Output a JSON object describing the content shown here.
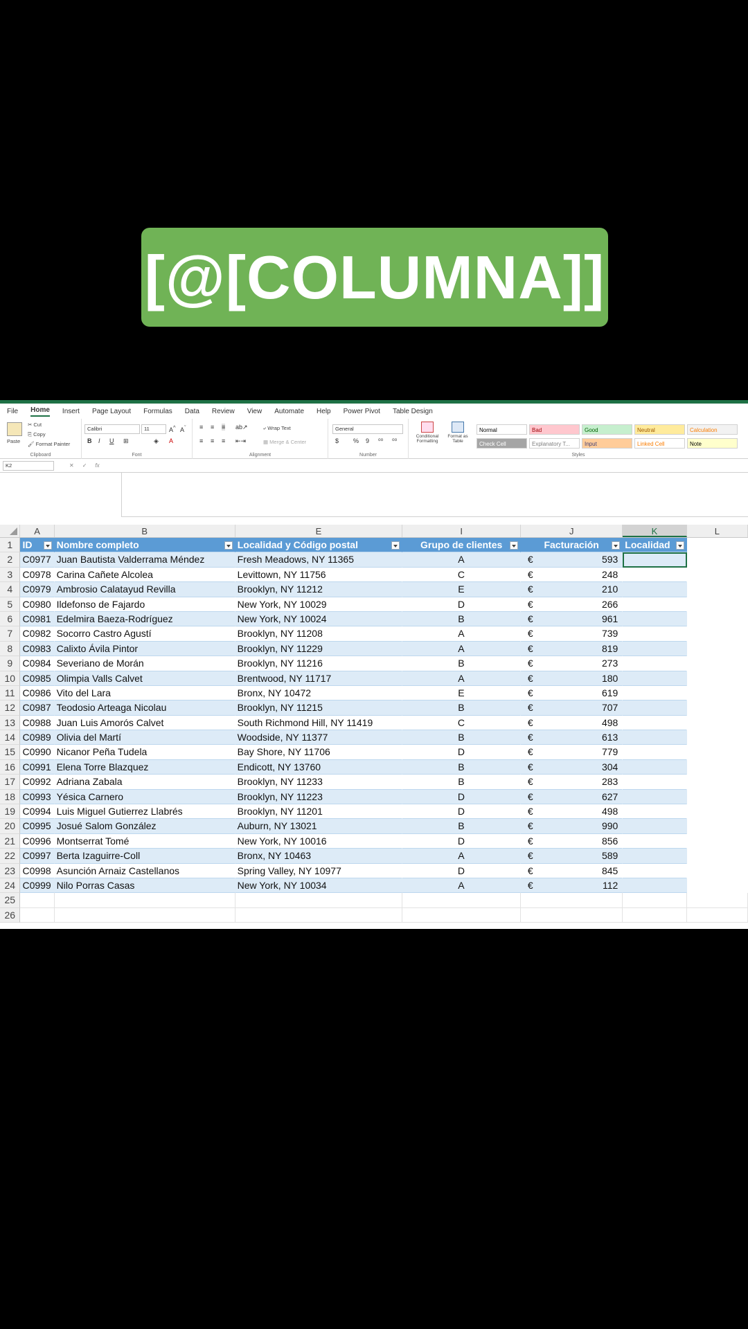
{
  "banner": {
    "title": "[@[COLUMNA]]"
  },
  "ribbon": {
    "tabs": [
      "File",
      "Home",
      "Insert",
      "Page Layout",
      "Formulas",
      "Data",
      "Review",
      "View",
      "Automate",
      "Help",
      "Power Pivot",
      "Table Design"
    ],
    "active_tab": "Home",
    "clipboard": {
      "paste": "Paste",
      "cut": "Cut",
      "copy": "Copy",
      "format_painter": "Format Painter",
      "label": "Clipboard"
    },
    "font": {
      "name": "Calibri",
      "size": "11",
      "label": "Font"
    },
    "alignment": {
      "wrap": "Wrap Text",
      "merge": "Merge & Center",
      "label": "Alignment"
    },
    "number": {
      "format": "General",
      "label": "Number"
    },
    "styles": {
      "conditional": "Conditional Formatting",
      "format_as_table": "Format as Table",
      "cells": [
        {
          "name": "Normal",
          "bg": "#ffffff",
          "fg": "#000000"
        },
        {
          "name": "Bad",
          "bg": "#ffc7ce",
          "fg": "#9c0006"
        },
        {
          "name": "Good",
          "bg": "#c6efce",
          "fg": "#006100"
        },
        {
          "name": "Neutral",
          "bg": "#ffeb9c",
          "fg": "#9c5700"
        },
        {
          "name": "Calculation",
          "bg": "#f2f2f2",
          "fg": "#fa7d00"
        },
        {
          "name": "Check Cell",
          "bg": "#a5a5a5",
          "fg": "#ffffff"
        },
        {
          "name": "Explanatory T...",
          "bg": "#ffffff",
          "fg": "#7f7f7f"
        },
        {
          "name": "Input",
          "bg": "#ffcc99",
          "fg": "#3f3f76"
        },
        {
          "name": "Linked Cell",
          "bg": "#ffffff",
          "fg": "#fa7d00"
        },
        {
          "name": "Note",
          "bg": "#ffffcc",
          "fg": "#000000"
        }
      ],
      "label": "Styles"
    }
  },
  "formula_bar": {
    "name_box": "K2",
    "value": ""
  },
  "columns": [
    "A",
    "B",
    "E",
    "I",
    "J",
    "K",
    "L"
  ],
  "table": {
    "headers": [
      "ID",
      "Nombre completo",
      "Localidad y Código postal",
      "Grupo de clientes",
      "Facturación",
      "Localidad"
    ],
    "currency": "€",
    "rows": [
      [
        "C0977",
        "Juan Bautista Valderrama Méndez",
        "Fresh Meadows, NY 11365",
        "A",
        "593"
      ],
      [
        "C0978",
        "Carina Cañete Alcolea",
        "Levittown, NY 11756",
        "C",
        "248"
      ],
      [
        "C0979",
        "Ambrosio Calatayud Revilla",
        "Brooklyn, NY 11212",
        "E",
        "210"
      ],
      [
        "C0980",
        "Ildefonso de Fajardo",
        "New York, NY 10029",
        "D",
        "266"
      ],
      [
        "C0981",
        "Edelmira Baeza-Rodríguez",
        "New York, NY 10024",
        "B",
        "961"
      ],
      [
        "C0982",
        "Socorro Castro Agustí",
        "Brooklyn, NY 11208",
        "A",
        "739"
      ],
      [
        "C0983",
        "Calixto Ávila Pintor",
        "Brooklyn, NY 11229",
        "A",
        "819"
      ],
      [
        "C0984",
        "Severiano de Morán",
        "Brooklyn, NY 11216",
        "B",
        "273"
      ],
      [
        "C0985",
        "Olimpia Valls Calvet",
        "Brentwood, NY 11717",
        "A",
        "180"
      ],
      [
        "C0986",
        "Vito del Lara",
        "Bronx, NY 10472",
        "E",
        "619"
      ],
      [
        "C0987",
        "Teodosio Arteaga Nicolau",
        "Brooklyn, NY 11215",
        "B",
        "707"
      ],
      [
        "C0988",
        "Juan Luis Amorós Calvet",
        "South Richmond Hill, NY 11419",
        "C",
        "498"
      ],
      [
        "C0989",
        "Olivia del Martí",
        "Woodside, NY 11377",
        "B",
        "613"
      ],
      [
        "C0990",
        "Nicanor Peña Tudela",
        "Bay Shore, NY 11706",
        "D",
        "779"
      ],
      [
        "C0991",
        "Elena Torre Blazquez",
        "Endicott, NY 13760",
        "B",
        "304"
      ],
      [
        "C0992",
        "Adriana Zabala",
        "Brooklyn, NY 11233",
        "B",
        "283"
      ],
      [
        "C0993",
        "Yésica Carnero",
        "Brooklyn, NY 11223",
        "D",
        "627"
      ],
      [
        "C0994",
        "Luis Miguel Gutierrez Llabrés",
        "Brooklyn, NY 11201",
        "D",
        "498"
      ],
      [
        "C0995",
        "Josué Salom González",
        "Auburn, NY 13021",
        "B",
        "990"
      ],
      [
        "C0996",
        "Montserrat Tomé",
        "New York, NY 10016",
        "D",
        "856"
      ],
      [
        "C0997",
        "Berta Izaguirre-Coll",
        "Bronx, NY 10463",
        "A",
        "589"
      ],
      [
        "C0998",
        "Asunción Arnaiz Castellanos",
        "Spring Valley, NY 10977",
        "D",
        "845"
      ],
      [
        "C0999",
        "Nilo Porras Casas",
        "New York, NY 10034",
        "A",
        "112"
      ]
    ],
    "empty_row_numbers": [
      "25",
      "26"
    ]
  }
}
